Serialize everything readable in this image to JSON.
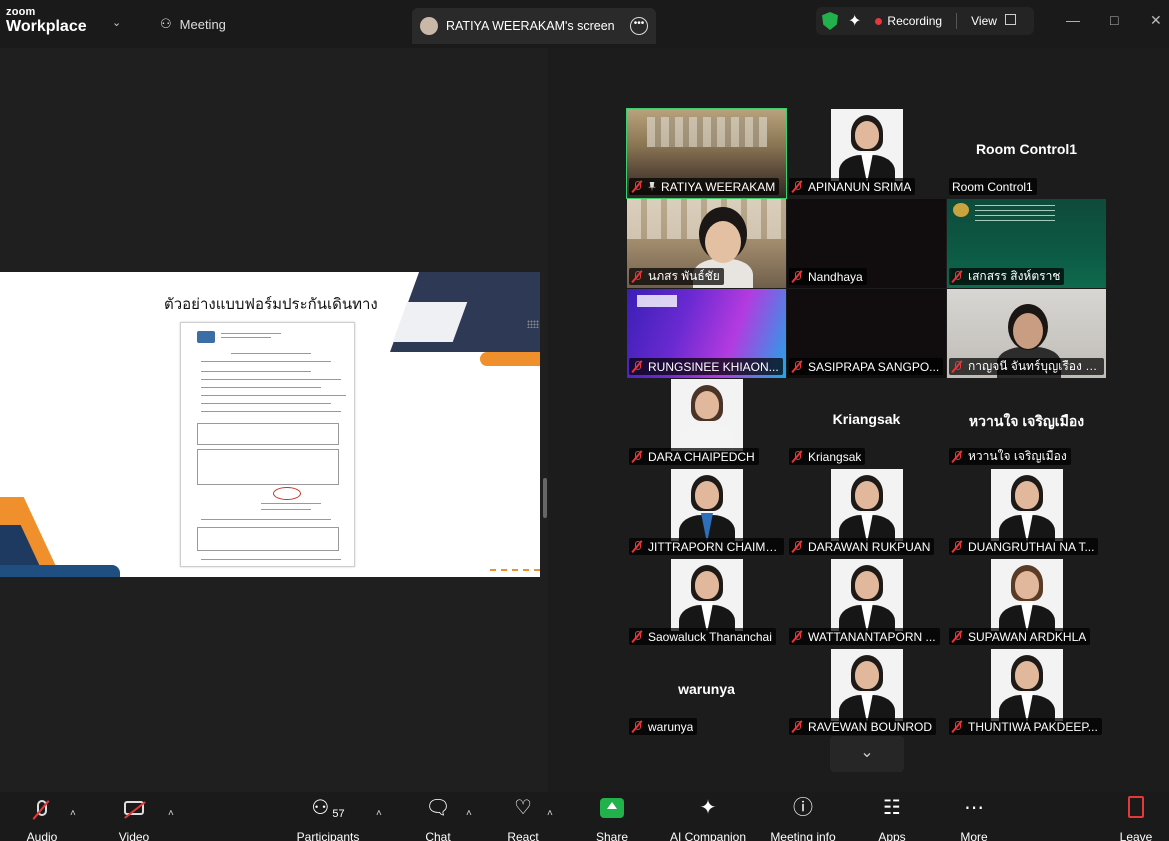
{
  "app": {
    "brand_top": "zoom",
    "brand_bottom": "Workplace"
  },
  "header": {
    "meeting_tab": "Meeting",
    "screen_tab": "RATIYA WEERAKAM's screen",
    "recording": "Recording",
    "view": "View"
  },
  "slide": {
    "title": "ตัวอย่างแบบฟอร์มประกันเดินทาง"
  },
  "gallery": {
    "tiles": [
      {
        "name": "RATIYA WEERAKAM"
      },
      {
        "name": "APINANUN SRIMA"
      },
      {
        "name": "Room Control1",
        "big": "Room Control1"
      },
      {
        "name": "นภสร พันธ์ชัย"
      },
      {
        "name": "Nandhaya"
      },
      {
        "name": "เสกสรร สิงห์ตราช"
      },
      {
        "name": "RUNGSINEE KHIAON..."
      },
      {
        "name": "SASIPRAPA SANGPO..."
      },
      {
        "name": "กาญจนี จันทร์บุญเรือง (ง..."
      },
      {
        "name": "DARA CHAIPEDCH"
      },
      {
        "name": "Kriangsak",
        "big": "Kriangsak"
      },
      {
        "name": "หวานใจ เจริญเมือง",
        "big": "หวานใจ เจริญเมือง"
      },
      {
        "name": "JITTRAPORN CHAIMA..."
      },
      {
        "name": "DARAWAN RUKPUAN"
      },
      {
        "name": "DUANGRUTHAI NA T..."
      },
      {
        "name": "Saowaluck Thananchai"
      },
      {
        "name": "WATTANANTAPORN ..."
      },
      {
        "name": "SUPAWAN ARDKHLA"
      },
      {
        "name": "warunya",
        "big": "warunya"
      },
      {
        "name": "RAVEWAN BOUNROD"
      },
      {
        "name": "THUNTIWA PAKDEEP..."
      }
    ]
  },
  "toolbar": {
    "audio": "Audio",
    "video": "Video",
    "participants": "Participants",
    "participants_count": "57",
    "chat": "Chat",
    "react": "React",
    "share": "Share",
    "ai": "AI Companion",
    "info": "Meeting info",
    "apps": "Apps",
    "more": "More",
    "leave": "Leave"
  },
  "colors": {
    "active_speaker": "#3ccf6e",
    "share_green": "#22b24c",
    "record_red": "#e5383b"
  }
}
